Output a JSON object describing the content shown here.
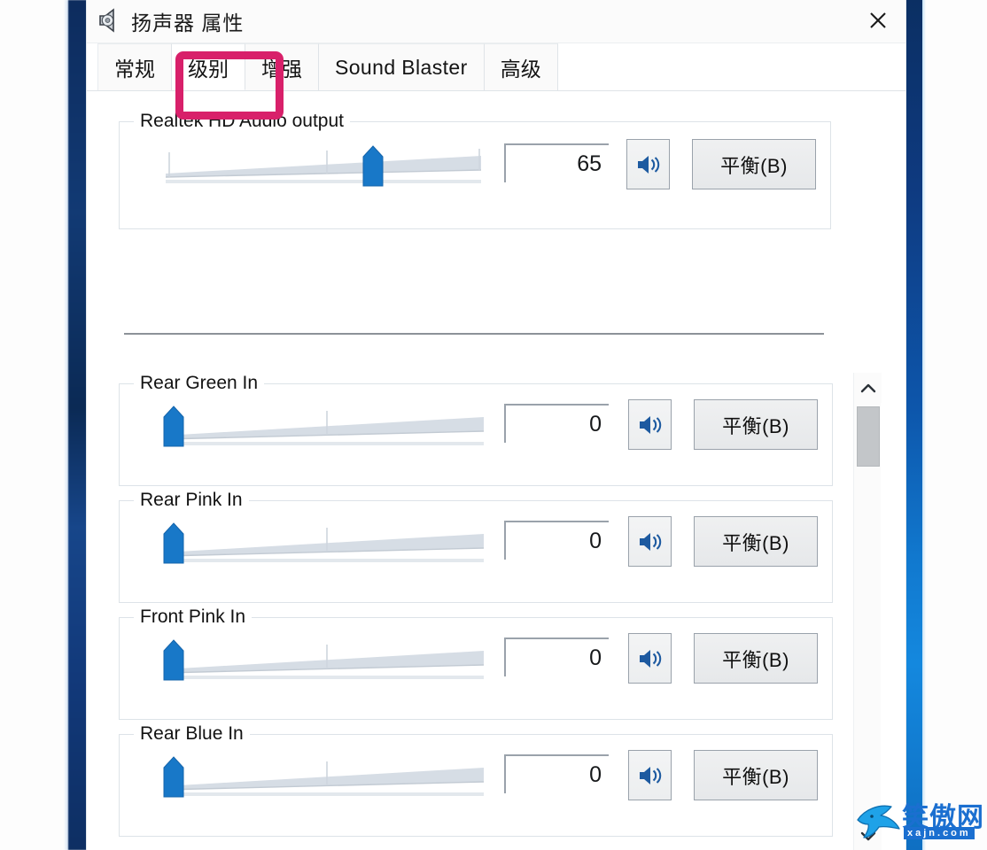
{
  "window": {
    "title": "扬声器 属性",
    "icon": "speaker-icon",
    "close_label": "✕"
  },
  "tabs": [
    {
      "label": "常规",
      "selected": false,
      "script": "cjk"
    },
    {
      "label": "级别",
      "selected": true,
      "script": "cjk"
    },
    {
      "label": "增强",
      "selected": false,
      "script": "cjk"
    },
    {
      "label": "Sound Blaster",
      "selected": false,
      "script": "latin"
    },
    {
      "label": "高级",
      "selected": false,
      "script": "cjk"
    }
  ],
  "annotation": {
    "highlight_color": "#d8206a",
    "target_tab": "级别"
  },
  "output_section": {
    "title": "Realtek HD Audio output",
    "value": "65",
    "slider_percent": 65,
    "mute_button_label": "speaker-icon",
    "balance_button_label": "平衡(B)"
  },
  "input_sections": [
    {
      "title": "Rear Green In",
      "value": "0",
      "slider_percent": 0,
      "mute_button_label": "speaker-icon",
      "balance_button_label": "平衡(B)"
    },
    {
      "title": "Rear Pink In",
      "value": "0",
      "slider_percent": 0,
      "mute_button_label": "speaker-icon",
      "balance_button_label": "平衡(B)"
    },
    {
      "title": "Front Pink In",
      "value": "0",
      "slider_percent": 0,
      "mute_button_label": "speaker-icon",
      "balance_button_label": "平衡(B)"
    },
    {
      "title": "Rear Blue In",
      "value": "0",
      "slider_percent": 0,
      "mute_button_label": "speaker-icon",
      "balance_button_label": "平衡(B)"
    }
  ],
  "scrollbar": {
    "up_arrow": "chevron-up-icon",
    "down_arrow": "chevron-down-icon",
    "thumb_position_percent": 4
  },
  "watermark": {
    "name": "笑傲网",
    "url": "xajn.com"
  },
  "colors": {
    "accent_blue": "#1b72c4",
    "thumb_blue": "#1878c8",
    "highlight_pink": "#d8206a",
    "title_text": "#1a1a1a"
  }
}
